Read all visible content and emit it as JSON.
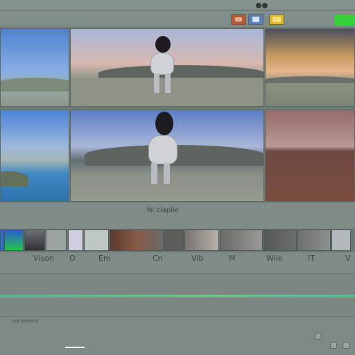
{
  "toolbar": {
    "logo_icon": "app-logo-icon",
    "buttons": [
      {
        "name": "media-button",
        "icon": "film-icon",
        "color": "#b35b39"
      },
      {
        "name": "photo-button",
        "icon": "image-icon",
        "color": "#5a7fb6"
      },
      {
        "name": "folder-button",
        "icon": "folder-icon",
        "color": "#e0b62c"
      }
    ],
    "accent_button": {
      "name": "render-button",
      "color": "#37d03a"
    }
  },
  "viewer": {
    "caption": "Ni ciaplie"
  },
  "timeline": {
    "labels": [
      "Vison",
      "O",
      "Em",
      "Cn",
      "Vib",
      "M",
      "Wile",
      "IT",
      "V"
    ]
  },
  "status": {
    "text": "aa aaaaa"
  },
  "colors": {
    "track_green": "#48e072",
    "track_blue": "#5fa2c8",
    "background": "#7e8b86"
  }
}
